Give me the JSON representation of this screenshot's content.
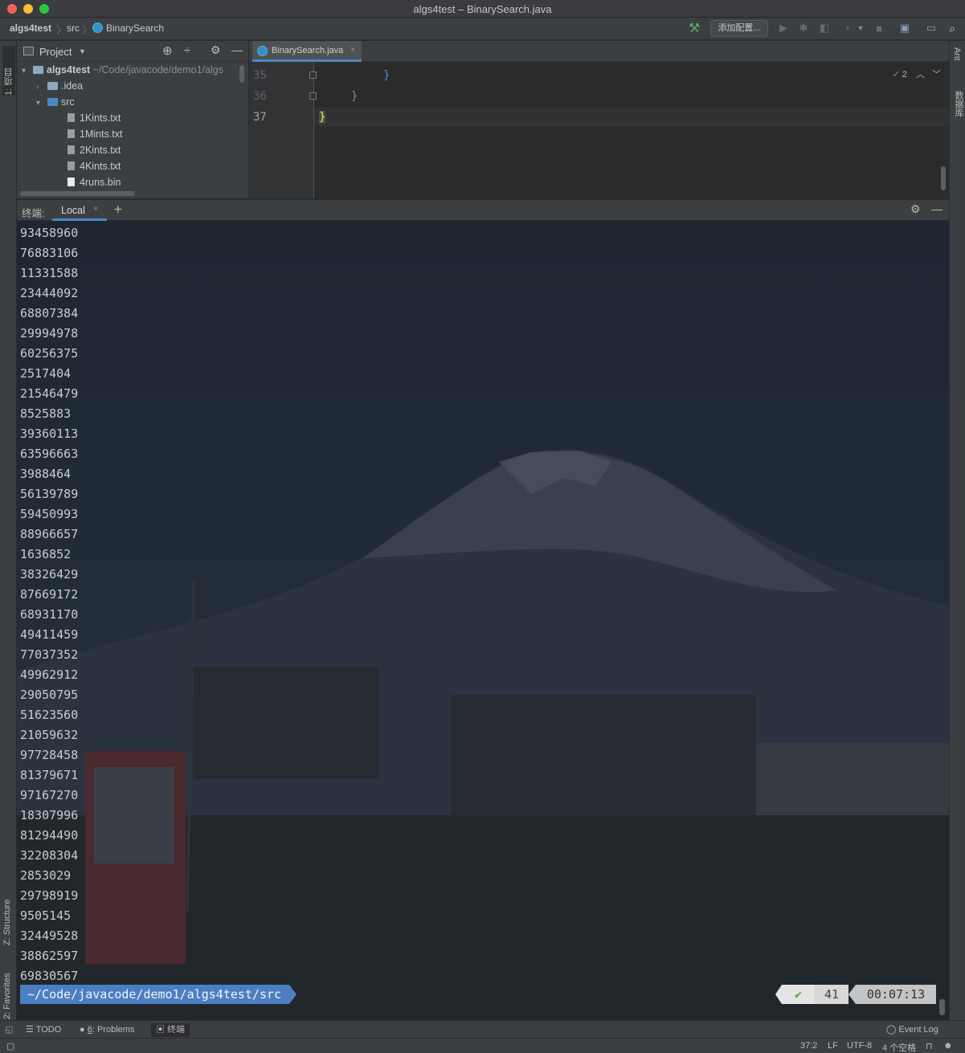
{
  "window": {
    "title": "algs4test – BinarySearch.java"
  },
  "nav": {
    "project": "algs4test",
    "folder": "src",
    "file": "BinarySearch",
    "config_button": "添加配置..."
  },
  "left_stripe": {
    "project_tab": "1: 项目",
    "structure_tab": "Z: Structure",
    "favorites_tab": "2: Favorites"
  },
  "right_stripe": {
    "ant_tab": "Ant",
    "database_tab": "数据库"
  },
  "project_panel": {
    "title": "Project",
    "root_name": "algs4test",
    "root_path": "~/Code/javacode/demo1/algs",
    "items": [
      {
        "label": ".idea"
      },
      {
        "label": "src"
      },
      {
        "label": "1Kints.txt"
      },
      {
        "label": "1Mints.txt"
      },
      {
        "label": "2Kints.txt"
      },
      {
        "label": "4Kints.txt"
      },
      {
        "label": "4runs.bin"
      }
    ]
  },
  "editor": {
    "tab_label": "BinarySearch.java",
    "inspection_count": "2",
    "lines": [
      {
        "num": "35",
        "text": "}"
      },
      {
        "num": "36",
        "text": "}"
      },
      {
        "num": "37",
        "text": "}"
      }
    ]
  },
  "terminal": {
    "label": "终端:",
    "tab_label": "Local",
    "lines": [
      "93458960",
      "76883106",
      "11331588",
      "23444092",
      "68807384",
      "29994978",
      "60256375",
      "2517404",
      "21546479",
      "8525883",
      "39360113",
      "63596663",
      "3988464",
      "56139789",
      "59450993",
      "88966657",
      "1636852",
      "38326429",
      "87669172",
      "68931170",
      "49411459",
      "77037352",
      "49962912",
      "29050795",
      "51623560",
      "21059632",
      "97728458",
      "81379671",
      "97167270",
      "18307996",
      "81294490",
      "32208304",
      "2853029",
      "29798919",
      "9505145",
      "32449528",
      "38862597",
      "69830567"
    ],
    "prompt_path": "~/Code/javacode/demo1/algs4test/src",
    "status_ok": "✔",
    "status_code": "41",
    "elapsed": "00:07:13"
  },
  "tool_strip": {
    "todo": "TODO",
    "problems_num": "6",
    "problems": ": Problems",
    "terminal": "终端",
    "event_log": "Event Log"
  },
  "status_bar": {
    "position": "37:2",
    "line_sep": "LF",
    "encoding": "UTF-8",
    "indent": "4 个空格"
  }
}
